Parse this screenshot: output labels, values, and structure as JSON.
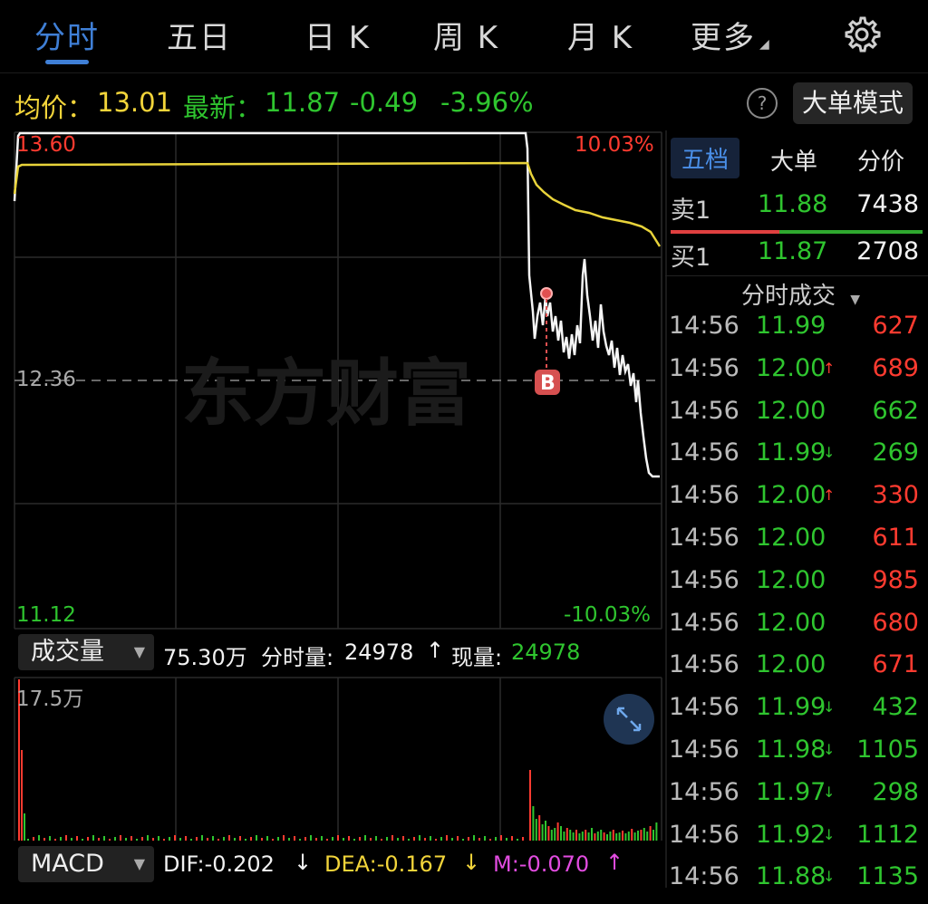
{
  "tabs": [
    {
      "label": "分时",
      "active": true
    },
    {
      "label": "五日",
      "active": false
    },
    {
      "label": "日 K",
      "active": false
    },
    {
      "label": "周 K",
      "active": false
    },
    {
      "label": "月 K",
      "active": false
    },
    {
      "label": "更多",
      "active": false
    }
  ],
  "info": {
    "avg_label": "均价：",
    "avg_value": "13.01",
    "latest_label": "最新：",
    "latest_value": "11.87",
    "change": "-0.49",
    "change_pct": "-3.96%",
    "help": "?",
    "mode_button": "大单模式"
  },
  "chart": {
    "price_high": "13.60",
    "pct_high": "10.03%",
    "price_prev_close": "12.36",
    "price_low": "11.12",
    "pct_low": "-10.03%",
    "trade_marker": "B",
    "watermark": "东方财富",
    "colors": {
      "price_line": "#f5f5f5",
      "avg_line": "#e8d33a",
      "up": "#ff3b30",
      "down": "#2fc52f"
    }
  },
  "volume": {
    "selector": "成交量",
    "total": "75.30万",
    "minute_label": "分时量:",
    "minute_value": "24978",
    "current_label": "现量:",
    "current_value": "24978",
    "axis_max": "17.5万"
  },
  "macd": {
    "selector": "MACD",
    "dif": "DIF:-0.202",
    "dea": "DEA:-0.167",
    "m": "M:-0.070"
  },
  "order_book": {
    "tabs": [
      "五档",
      "大单",
      "分价"
    ],
    "sell1": {
      "label": "卖1",
      "price": "11.88",
      "vol": "7438"
    },
    "buy1": {
      "label": "买1",
      "price": "11.87",
      "vol": "2708"
    },
    "ticks_header": "分时成交",
    "ticks": [
      {
        "time": "14:56",
        "price": "11.99",
        "arrow": "",
        "vol": "627",
        "vol_color": "red"
      },
      {
        "time": "14:56",
        "price": "12.00",
        "arrow": "↑",
        "vol": "689",
        "vol_color": "red"
      },
      {
        "time": "14:56",
        "price": "12.00",
        "arrow": "",
        "vol": "662",
        "vol_color": "green"
      },
      {
        "time": "14:56",
        "price": "11.99",
        "arrow": "↓",
        "vol": "269",
        "vol_color": "green"
      },
      {
        "time": "14:56",
        "price": "12.00",
        "arrow": "↑",
        "vol": "330",
        "vol_color": "red"
      },
      {
        "time": "14:56",
        "price": "12.00",
        "arrow": "",
        "vol": "611",
        "vol_color": "red"
      },
      {
        "time": "14:56",
        "price": "12.00",
        "arrow": "",
        "vol": "985",
        "vol_color": "red"
      },
      {
        "time": "14:56",
        "price": "12.00",
        "arrow": "",
        "vol": "680",
        "vol_color": "red"
      },
      {
        "time": "14:56",
        "price": "12.00",
        "arrow": "",
        "vol": "671",
        "vol_color": "red"
      },
      {
        "time": "14:56",
        "price": "11.99",
        "arrow": "↓",
        "vol": "432",
        "vol_color": "green"
      },
      {
        "time": "14:56",
        "price": "11.98",
        "arrow": "↓",
        "vol": "1105",
        "vol_color": "green"
      },
      {
        "time": "14:56",
        "price": "11.97",
        "arrow": "↓",
        "vol": "298",
        "vol_color": "green"
      },
      {
        "time": "14:56",
        "price": "11.92",
        "arrow": "↓",
        "vol": "1112",
        "vol_color": "green"
      },
      {
        "time": "14:56",
        "price": "11.88",
        "arrow": "↓",
        "vol": "1135",
        "vol_color": "green"
      }
    ]
  }
}
